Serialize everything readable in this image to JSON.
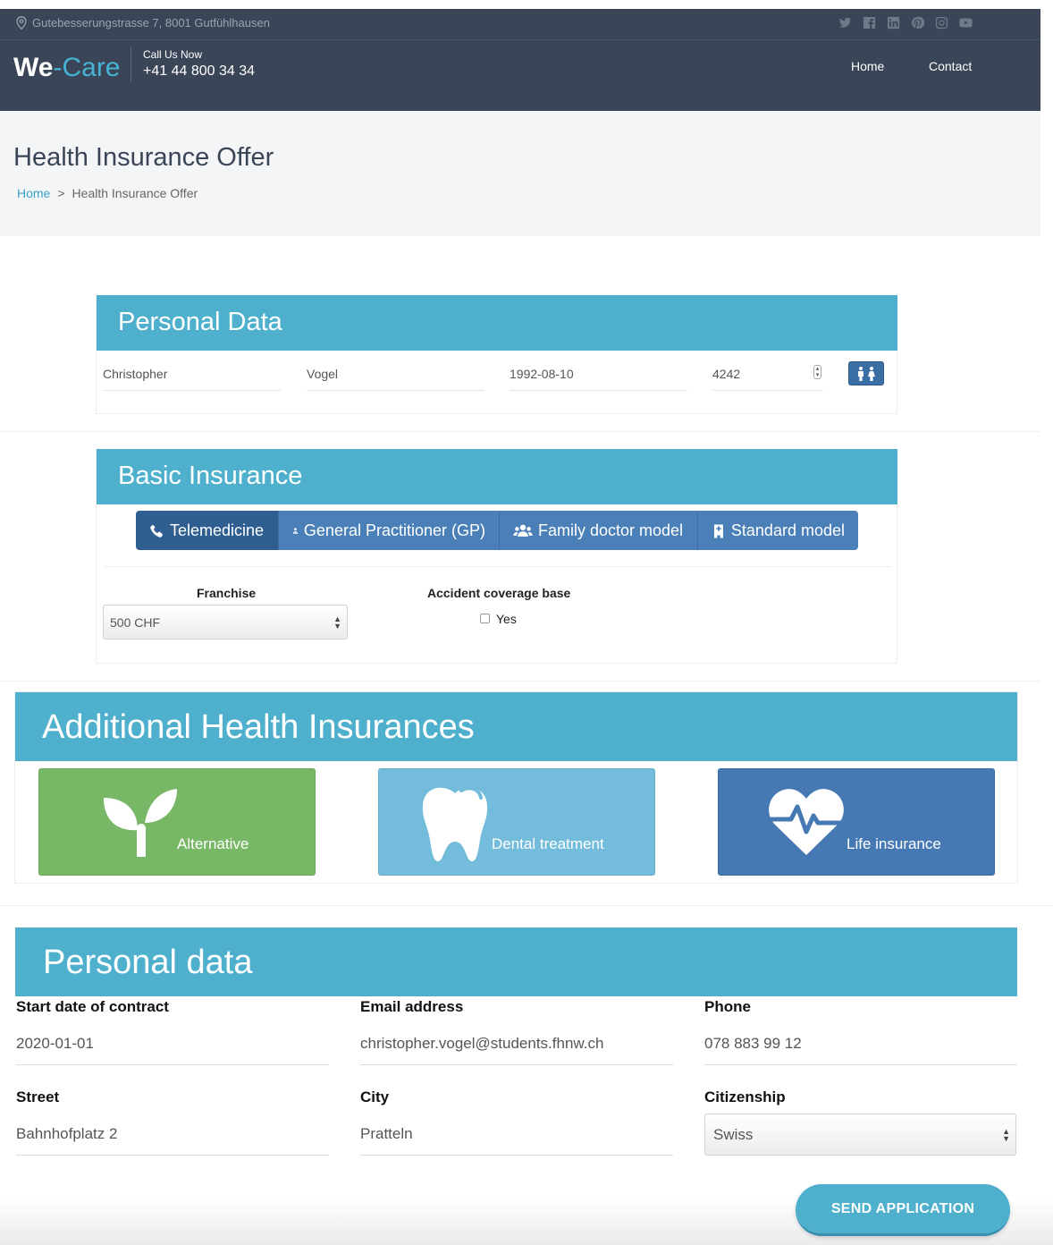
{
  "topbar": {
    "address": "Gutebesserungstrasse 7, 8001 Gutfühlhausen",
    "social_icons": [
      "twitter-icon",
      "facebook-icon",
      "linkedin-icon",
      "pinterest-icon",
      "instagram-icon",
      "youtube-icon"
    ]
  },
  "header": {
    "logo_we": "We",
    "logo_dash": "-",
    "logo_care": "Care",
    "call_label": "Call Us Now",
    "phone": "+41 44 800 34 34",
    "nav": [
      "Home",
      "Contact"
    ]
  },
  "page": {
    "title": "Health Insurance Offer",
    "breadcrumb_home": "Home",
    "breadcrumb_sep": ">",
    "breadcrumb_current": "Health Insurance Offer"
  },
  "personal_data_card": {
    "heading": "Personal Data",
    "first_name": "Christopher",
    "last_name": "Vogel",
    "birthdate": "1992-08-10",
    "zip": "4242"
  },
  "basic_insurance": {
    "heading": "Basic Insurance",
    "models": [
      {
        "label": "Telemedicine",
        "icon": "phone-icon",
        "active": true
      },
      {
        "label": "General Practitioner (GP)",
        "icon": "doctor-icon",
        "active": false
      },
      {
        "label": "Family doctor model",
        "icon": "users-icon",
        "active": false
      },
      {
        "label": "Standard model",
        "icon": "hospital-icon",
        "active": false
      }
    ],
    "franchise_label": "Franchise",
    "franchise_value": "500 CHF",
    "accident_label": "Accident coverage base",
    "accident_option": "Yes"
  },
  "additional": {
    "heading": "Additional Health Insurances",
    "tiles": [
      {
        "label": "Alternative",
        "icon": "sprout-icon",
        "color": "#77b766"
      },
      {
        "label": "Dental treatment",
        "icon": "tooth-icon",
        "color": "#74bcdb"
      },
      {
        "label": "Life insurance",
        "icon": "heart-pulse-icon",
        "color": "#4679b4"
      }
    ]
  },
  "contract": {
    "heading": "Personal data",
    "start_label": "Start date of contract",
    "start_value": "2020-01-01",
    "email_label": "Email address",
    "email_value": "christopher.vogel@students.fhnw.ch",
    "phone_label": "Phone",
    "phone_value": "078 883 99 12",
    "street_label": "Street",
    "street_value": "Bahnhofplatz 2",
    "city_label": "City",
    "city_value": "Pratteln",
    "citizenship_label": "Citizenship",
    "citizenship_value": "Swiss",
    "send_label": "SEND APPLICATION"
  }
}
